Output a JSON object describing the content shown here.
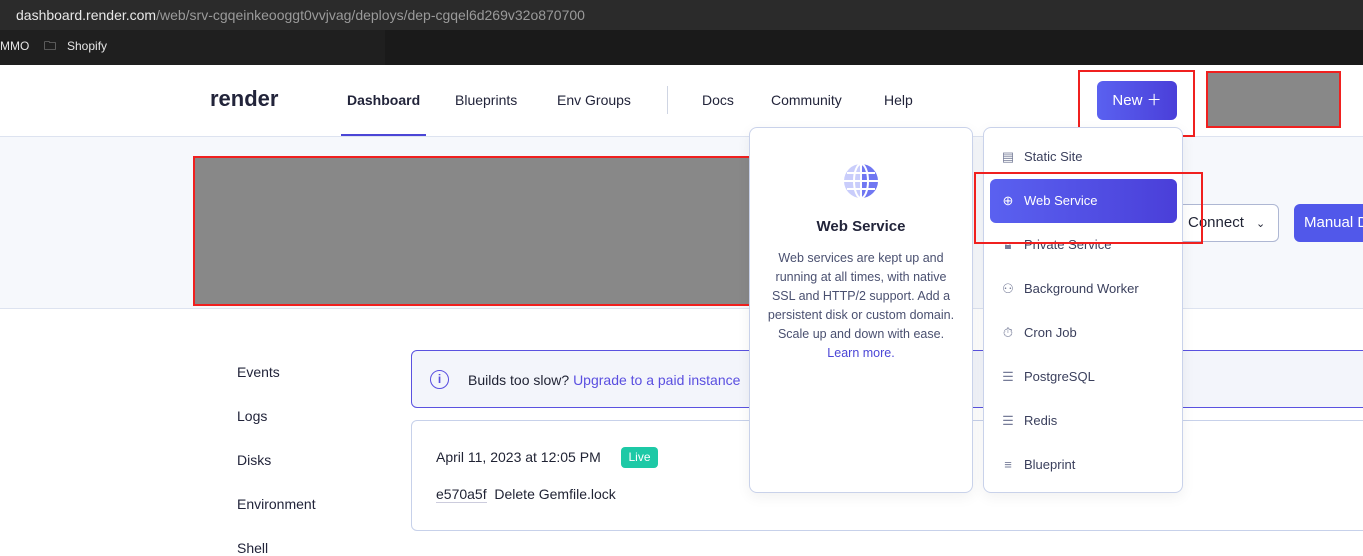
{
  "browser": {
    "url_host": "dashboard.render.com",
    "url_path": "/web/srv-cgqeinkeooggt0vvjvag/deploys/dep-cgqel6d269v32o870700",
    "bookmarks": [
      "MMO",
      "Shopify"
    ]
  },
  "header": {
    "logo": "render",
    "nav": [
      "Dashboard",
      "Blueprints",
      "Env Groups",
      "Docs",
      "Community",
      "Help"
    ],
    "new_label": "New",
    "new_icon": "plus-icon"
  },
  "service": {
    "connect_label": "Connect",
    "manual_deploy_label": "Manual Deploy"
  },
  "sidebar": [
    "Events",
    "Logs",
    "Disks",
    "Environment",
    "Shell"
  ],
  "banner": {
    "text": "Builds too slow?",
    "link": "Upgrade to a paid instance"
  },
  "deploy": {
    "date": "April 11, 2023 at 12:05 PM",
    "status": "Live",
    "commit": "e570a5f",
    "message": "Delete Gemfile.lock"
  },
  "preview": {
    "title": "Web Service",
    "description": "Web services are kept up and running at all times, with native SSL and HTTP/2 support. Add a persistent disk or custom domain. Scale up and down with ease.",
    "link": "Learn more."
  },
  "new_menu": [
    {
      "label": "Static Site",
      "icon": "static-site-icon"
    },
    {
      "label": "Web Service",
      "icon": "globe-icon",
      "selected": true
    },
    {
      "label": "Private Service",
      "icon": "lock-icon"
    },
    {
      "label": "Background Worker",
      "icon": "worker-icon"
    },
    {
      "label": "Cron Job",
      "icon": "stopwatch-icon"
    },
    {
      "label": "PostgreSQL",
      "icon": "database-icon"
    },
    {
      "label": "Redis",
      "icon": "database-icon"
    },
    {
      "label": "Blueprint",
      "icon": "blueprint-icon"
    }
  ],
  "colors": {
    "accent": "#4b46d6",
    "live": "#1dc9a6",
    "annotation": "#f0201f"
  }
}
